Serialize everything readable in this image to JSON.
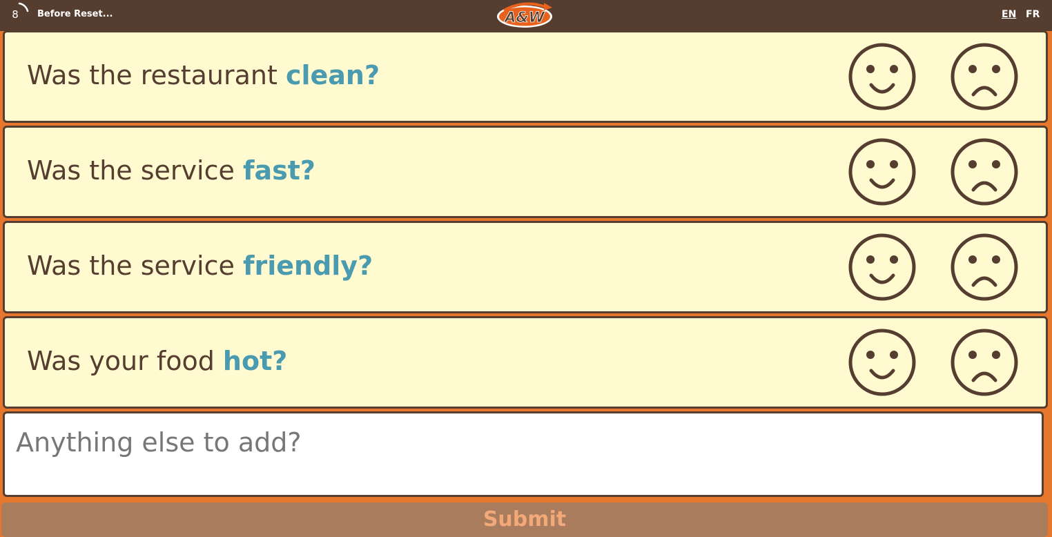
{
  "header": {
    "countdown": "8",
    "reset_label": "Before Reset...",
    "logo_text": "A&W",
    "lang_en": "EN",
    "lang_fr": "FR"
  },
  "questions": [
    {
      "prefix": "Was the restaurant ",
      "keyword": "clean?"
    },
    {
      "prefix": "Was the service ",
      "keyword": "fast?"
    },
    {
      "prefix": "Was the service ",
      "keyword": "friendly?"
    },
    {
      "prefix": "Was your food ",
      "keyword": "hot?"
    }
  ],
  "comment": {
    "placeholder": "Anything else to add?",
    "value": ""
  },
  "submit_label": "Submit",
  "colors": {
    "header_bg": "#553d2f",
    "page_bg": "#e8772e",
    "card_bg": "#fffad0",
    "keyword": "#4a9bb0",
    "brown": "#553d2f"
  },
  "icons": {
    "happy": "smiley-face-icon",
    "sad": "frowning-face-icon"
  }
}
